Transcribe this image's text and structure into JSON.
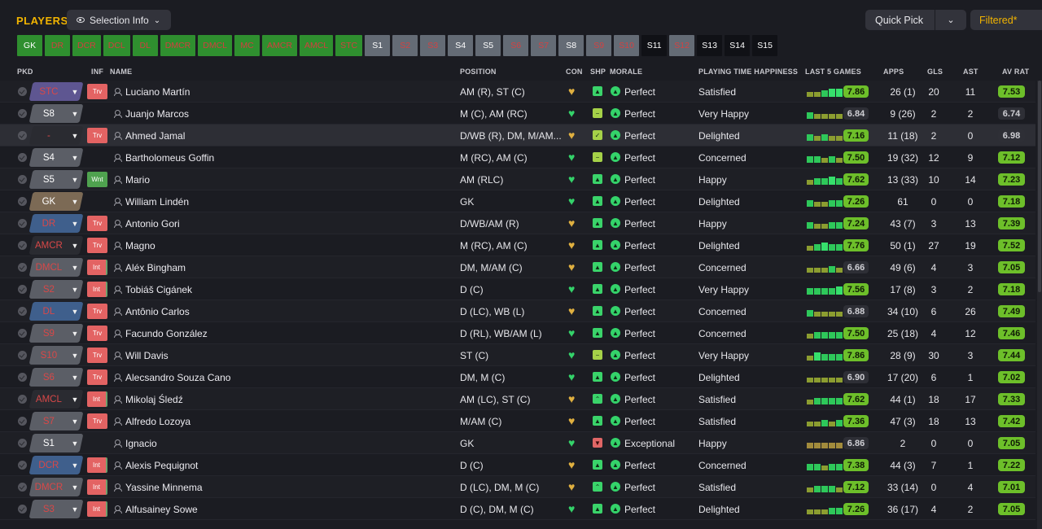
{
  "header": {
    "title": "PLAYERS",
    "selection_info": "Selection Info",
    "quick_pick": "Quick Pick",
    "filtered": "Filtered*"
  },
  "strip": [
    {
      "label": "GK",
      "style": "pos-gk"
    },
    {
      "label": "DR",
      "style": "pos"
    },
    {
      "label": "DCR",
      "style": "pos"
    },
    {
      "label": "DCL",
      "style": "pos"
    },
    {
      "label": "DL",
      "style": "pos"
    },
    {
      "label": "DMCR",
      "style": "pos"
    },
    {
      "label": "DMCL",
      "style": "pos"
    },
    {
      "label": "MC",
      "style": "pos"
    },
    {
      "label": "AMCR",
      "style": "pos"
    },
    {
      "label": "AMCL",
      "style": "pos"
    },
    {
      "label": "STC",
      "style": "pos"
    },
    {
      "label": "S1",
      "style": "sg"
    },
    {
      "label": "S2",
      "style": "sr"
    },
    {
      "label": "S3",
      "style": "sr"
    },
    {
      "label": "S4",
      "style": "sg"
    },
    {
      "label": "S5",
      "style": "sg"
    },
    {
      "label": "S6",
      "style": "sr"
    },
    {
      "label": "S7",
      "style": "sr"
    },
    {
      "label": "S8",
      "style": "sg"
    },
    {
      "label": "S9",
      "style": "sr"
    },
    {
      "label": "S10",
      "style": "sr"
    },
    {
      "label": "S11",
      "style": "sb"
    },
    {
      "label": "S12",
      "style": "sr"
    },
    {
      "label": "S13",
      "style": "sb"
    },
    {
      "label": "S14",
      "style": "sb"
    },
    {
      "label": "S15",
      "style": "sb"
    }
  ],
  "columns": {
    "pkd": "PKD",
    "inf": "INF",
    "name": "NAME",
    "position": "POSITION",
    "con": "CON",
    "shp": "SHP",
    "morale": "MORALE",
    "pth": "PLAYING TIME HAPPINESS",
    "last5": "LAST 5 GAMES",
    "apps": "APPS",
    "gls": "GLS",
    "ast": "AST",
    "avrat": "AV RAT"
  },
  "colors": {
    "accent": "#f2b400",
    "good": "#34d36a",
    "bad": "#e36363"
  },
  "players": [
    {
      "sel": "STC",
      "ps": "ps-purple",
      "inf": "Trv",
      "name": "Luciano Martín",
      "position": "AM (R), ST (C)",
      "con": "y",
      "shp": "g",
      "shp_icon": "thumb-up-icon",
      "morale": "Perfect",
      "pth": "Satisfied",
      "bars": [
        "b1",
        "b1",
        "b2",
        "b3",
        "b3"
      ],
      "last5": "7.86",
      "l5hi": true,
      "apps": "26 (1)",
      "gls": "20",
      "ast": "11",
      "avrat": "7.53",
      "avhi": true
    },
    {
      "sel": "S8",
      "ps": "ps-grey",
      "inf": "",
      "name": "Juanjo Marcos",
      "position": "M (C), AM (RC)",
      "con": "g",
      "shp": "l",
      "shp_icon": "neutral-icon",
      "morale": "Perfect",
      "pth": "Very Happy",
      "bars": [
        "b2",
        "b1",
        "b1",
        "b1",
        "b1"
      ],
      "last5": "6.84",
      "l5hi": false,
      "apps": "9 (26)",
      "gls": "2",
      "ast": "2",
      "avrat": "6.74",
      "avhi": false
    },
    {
      "sel": "-",
      "ps": "ps-dark",
      "inf": "Trv",
      "name": "Ahmed Jamal",
      "position": "D/WB (R), DM, M/AM...",
      "con": "y",
      "shp": "l",
      "shp_icon": "check-icon",
      "morale": "Perfect",
      "pth": "Delighted",
      "bars": [
        "b2",
        "b1",
        "b2",
        "b1",
        "b1"
      ],
      "last5": "7.16",
      "l5hi": true,
      "apps": "11 (18)",
      "gls": "2",
      "ast": "0",
      "avrat": "6.98",
      "avhi": false
    },
    {
      "sel": "S4",
      "ps": "ps-grey",
      "inf": "",
      "name": "Bartholomeus Goffin",
      "position": "M (RC), AM (C)",
      "con": "g",
      "shp": "l",
      "shp_icon": "neutral-icon",
      "morale": "Perfect",
      "pth": "Concerned",
      "bars": [
        "b2",
        "b2",
        "b1",
        "b2",
        "b1"
      ],
      "last5": "7.50",
      "l5hi": true,
      "apps": "19 (32)",
      "gls": "12",
      "ast": "9",
      "avrat": "7.12",
      "avhi": true
    },
    {
      "sel": "S5",
      "ps": "ps-grey",
      "inf": "Wnt",
      "name": "Mario",
      "position": "AM (RLC)",
      "con": "g",
      "shp": "g",
      "shp_icon": "thumb-up-icon",
      "morale": "Perfect",
      "pth": "Happy",
      "bars": [
        "b1",
        "b2",
        "b2",
        "b3",
        "b2"
      ],
      "last5": "7.62",
      "l5hi": true,
      "apps": "13 (33)",
      "gls": "10",
      "ast": "14",
      "avrat": "7.23",
      "avhi": true
    },
    {
      "sel": "GK",
      "ps": "ps-brown",
      "inf": "",
      "name": "William Lindén",
      "position": "GK",
      "con": "g",
      "shp": "g",
      "shp_icon": "thumb-up-icon",
      "morale": "Perfect",
      "pth": "Delighted",
      "bars": [
        "b2",
        "b1",
        "b1",
        "b2",
        "b2"
      ],
      "last5": "7.26",
      "l5hi": true,
      "apps": "61",
      "gls": "0",
      "ast": "0",
      "avrat": "7.18",
      "avhi": true
    },
    {
      "sel": "DR",
      "ps": "ps-blue",
      "inf": "Trv",
      "name": "Antonio Gori",
      "position": "D/WB/AM (R)",
      "con": "y",
      "shp": "g",
      "shp_icon": "thumb-up-icon",
      "morale": "Perfect",
      "pth": "Happy",
      "bars": [
        "b2",
        "b1",
        "b1",
        "b2",
        "b2"
      ],
      "last5": "7.24",
      "l5hi": true,
      "apps": "43 (7)",
      "gls": "3",
      "ast": "13",
      "avrat": "7.39",
      "avhi": true
    },
    {
      "sel": "AMCR",
      "ps": "ps-dark",
      "inf": "Trv",
      "name": "Magno",
      "position": "M (RC), AM (C)",
      "con": "y",
      "shp": "g",
      "shp_icon": "thumb-up-icon",
      "morale": "Perfect",
      "pth": "Delighted",
      "bars": [
        "b1",
        "b2",
        "b3",
        "b2",
        "b2"
      ],
      "last5": "7.76",
      "l5hi": true,
      "apps": "50 (1)",
      "gls": "27",
      "ast": "19",
      "avrat": "7.52",
      "avhi": true
    },
    {
      "sel": "DMCL",
      "ps": "ps-grey-red",
      "inf": "Int",
      "name": "Aléx Bingham",
      "position": "DM, M/AM (C)",
      "con": "y",
      "shp": "g",
      "shp_icon": "thumb-up-icon",
      "morale": "Perfect",
      "pth": "Concerned",
      "bars": [
        "b1",
        "b1",
        "b1",
        "b2",
        "b1"
      ],
      "last5": "6.66",
      "l5hi": false,
      "apps": "49 (6)",
      "gls": "4",
      "ast": "3",
      "avrat": "7.05",
      "avhi": true
    },
    {
      "sel": "S2",
      "ps": "ps-grey-red",
      "inf": "Int",
      "name": "Tobiáš Cigánek",
      "position": "D (C)",
      "con": "g",
      "shp": "g",
      "shp_icon": "thumb-up-icon",
      "morale": "Perfect",
      "pth": "Very Happy",
      "bars": [
        "b2",
        "b2",
        "b2",
        "b2",
        "b3"
      ],
      "last5": "7.56",
      "l5hi": true,
      "apps": "17 (8)",
      "gls": "3",
      "ast": "2",
      "avrat": "7.18",
      "avhi": true
    },
    {
      "sel": "DL",
      "ps": "ps-blue",
      "inf": "Trv",
      "name": "Antônio Carlos",
      "position": "D (LC), WB (L)",
      "con": "y",
      "shp": "g",
      "shp_icon": "thumb-up-icon",
      "morale": "Perfect",
      "pth": "Concerned",
      "bars": [
        "b2",
        "b1",
        "b1",
        "b1",
        "b1"
      ],
      "last5": "6.88",
      "l5hi": false,
      "apps": "34 (10)",
      "gls": "6",
      "ast": "26",
      "avrat": "7.49",
      "avhi": true
    },
    {
      "sel": "S9",
      "ps": "ps-grey-red",
      "inf": "Trv",
      "name": "Facundo González",
      "position": "D (RL), WB/AM (L)",
      "con": "g",
      "shp": "g",
      "shp_icon": "thumb-up-icon",
      "morale": "Perfect",
      "pth": "Concerned",
      "bars": [
        "b1",
        "b2",
        "b2",
        "b2",
        "b2"
      ],
      "last5": "7.50",
      "l5hi": true,
      "apps": "25 (18)",
      "gls": "4",
      "ast": "12",
      "avrat": "7.46",
      "avhi": true
    },
    {
      "sel": "S10",
      "ps": "ps-grey-red",
      "inf": "Trv",
      "name": "Will Davis",
      "position": "ST (C)",
      "con": "g",
      "shp": "l",
      "shp_icon": "neutral-icon",
      "morale": "Perfect",
      "pth": "Very Happy",
      "bars": [
        "b1",
        "b3",
        "b2",
        "b2",
        "b2"
      ],
      "last5": "7.86",
      "l5hi": true,
      "apps": "28 (9)",
      "gls": "30",
      "ast": "3",
      "avrat": "7.44",
      "avhi": true
    },
    {
      "sel": "S6",
      "ps": "ps-grey-red",
      "inf": "Trv",
      "name": "Alecsandro Souza Cano",
      "position": "DM, M (C)",
      "con": "g",
      "shp": "g",
      "shp_icon": "thumb-up-icon",
      "morale": "Perfect",
      "pth": "Delighted",
      "bars": [
        "b1",
        "b1",
        "b1",
        "b1",
        "b1"
      ],
      "last5": "6.90",
      "l5hi": false,
      "apps": "17 (20)",
      "gls": "6",
      "ast": "1",
      "avrat": "7.02",
      "avhi": true
    },
    {
      "sel": "AMCL",
      "ps": "ps-dark",
      "inf": "Int",
      "name": "Mikolaj Śledź",
      "position": "AM (LC), ST (C)",
      "con": "y",
      "shp": "g",
      "shp_icon": "arrow-up-icon",
      "morale": "Perfect",
      "pth": "Satisfied",
      "bars": [
        "b1",
        "b2",
        "b2",
        "b2",
        "b2"
      ],
      "last5": "7.62",
      "l5hi": true,
      "apps": "44 (1)",
      "gls": "18",
      "ast": "17",
      "avrat": "7.33",
      "avhi": true
    },
    {
      "sel": "S7",
      "ps": "ps-grey-red",
      "inf": "Trv",
      "name": "Alfredo Lozoya",
      "position": "M/AM (C)",
      "con": "y",
      "shp": "g",
      "shp_icon": "thumb-up-icon",
      "morale": "Perfect",
      "pth": "Satisfied",
      "bars": [
        "b1",
        "b1",
        "b2",
        "b1",
        "b2"
      ],
      "last5": "7.36",
      "l5hi": true,
      "apps": "47 (3)",
      "gls": "18",
      "ast": "13",
      "avrat": "7.42",
      "avhi": true
    },
    {
      "sel": "S1",
      "ps": "ps-grey",
      "inf": "",
      "name": "Ignacio",
      "position": "GK",
      "con": "g",
      "shp": "r",
      "shp_icon": "thumb-down-icon",
      "morale": "Exceptional",
      "pth": "Happy",
      "bars": [
        "b0",
        "b0",
        "b0",
        "b0",
        "b0"
      ],
      "last5": "6.86",
      "l5hi": false,
      "apps": "2",
      "gls": "0",
      "ast": "0",
      "avrat": "7.05",
      "avhi": true
    },
    {
      "sel": "DCR",
      "ps": "ps-blue",
      "inf": "Int",
      "name": "Alexis Pequignot",
      "position": "D (C)",
      "con": "y",
      "shp": "g",
      "shp_icon": "thumb-up-icon",
      "morale": "Perfect",
      "pth": "Concerned",
      "bars": [
        "b2",
        "b2",
        "b1",
        "b2",
        "b2"
      ],
      "last5": "7.38",
      "l5hi": true,
      "apps": "44 (3)",
      "gls": "7",
      "ast": "1",
      "avrat": "7.22",
      "avhi": true
    },
    {
      "sel": "DMCR",
      "ps": "ps-grey-red",
      "inf": "Int",
      "name": "Yassine Minnema",
      "position": "D (LC), DM, M (C)",
      "con": "y",
      "shp": "g",
      "shp_icon": "arrow-up-icon",
      "morale": "Perfect",
      "pth": "Satisfied",
      "bars": [
        "b1",
        "b2",
        "b2",
        "b2",
        "b1"
      ],
      "last5": "7.12",
      "l5hi": true,
      "apps": "33 (14)",
      "gls": "0",
      "ast": "4",
      "avrat": "7.01",
      "avhi": true
    },
    {
      "sel": "S3",
      "ps": "ps-grey-red",
      "inf": "Int",
      "name": "Alfusainey Sowe",
      "position": "D (C), DM, M (C)",
      "con": "g",
      "shp": "g",
      "shp_icon": "thumb-up-icon",
      "morale": "Perfect",
      "pth": "Delighted",
      "bars": [
        "b1",
        "b1",
        "b1",
        "b2",
        "b2"
      ],
      "last5": "7.26",
      "l5hi": true,
      "apps": "36 (17)",
      "gls": "4",
      "ast": "2",
      "avrat": "7.05",
      "avhi": true
    }
  ]
}
